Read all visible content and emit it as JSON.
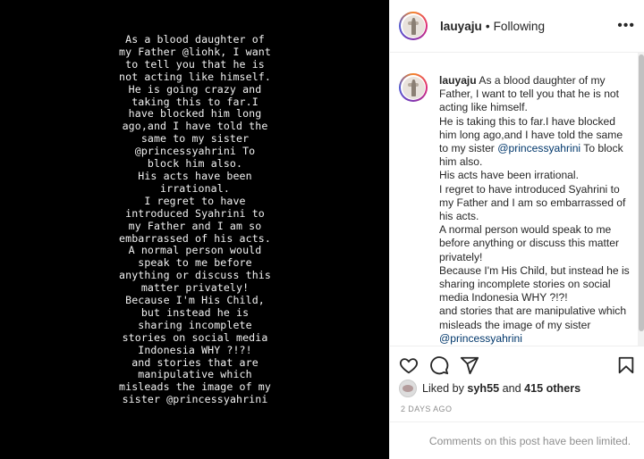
{
  "story": {
    "lines": [
      "As a blood daughter of",
      "my Father @liohk, I want",
      "to tell you that he is",
      "not acting like himself.",
      "He is going crazy and",
      "taking this to far.I",
      "have blocked him long",
      "ago,and I have told the",
      "same to my sister",
      "@princessyahrini To",
      "block him also.",
      "His acts have been",
      "irrational.",
      "I regret to have",
      "introduced Syahrini to",
      "my Father and I am so",
      "embarrassed of his acts.",
      "A normal person would",
      "speak to me before",
      "anything or discuss this",
      "matter privately!",
      "Because I'm His Child,",
      "but instead he is",
      "sharing incomplete",
      "stories on social media",
      "Indonesia WHY ?!?!",
      "and stories that are",
      "manipulative which",
      "misleads the image of my",
      "sister @princessyahrini"
    ]
  },
  "header": {
    "username": "lauyaju",
    "separator": "•",
    "follow_status": "Following",
    "more_icon": "more-horizontal-icon"
  },
  "caption": {
    "username": "lauyaju",
    "first_line": "As a blood daughter of my Father, I want to tell you that he is not acting like himself.",
    "line2_pre": "He is taking this to far.I have blocked him long ago,and I have told the same to my sister ",
    "line2_mention": "@princessyahrini",
    "line2_post": " To block him also.",
    "line3": "His acts have been irrational.",
    "line4": "I regret to have introduced Syahrini to my Father and I am so embarrassed of his acts.",
    "line5": "A normal person would speak to me before anything or discuss this matter privately!",
    "line6": "Because I'm His Child, but instead he is sharing incomplete stories on social media Indonesia WHY ?!?!",
    "line7": "and stories that are manipulative which misleads the image of my sister ",
    "line7_mention": "@princessyahrini"
  },
  "actions": {
    "like_icon": "heart-icon",
    "comment_icon": "comment-icon",
    "share_icon": "share-icon",
    "save_icon": "bookmark-icon"
  },
  "likes": {
    "prefix": "Liked by ",
    "user": "syh55",
    "middle": " and ",
    "others": "415 others"
  },
  "timestamp": "2 DAYS AGO",
  "comments_limited": "Comments on this post have been limited.",
  "colors": {
    "mention": "#00376b",
    "muted": "#8e8e8e",
    "text": "#262626"
  }
}
